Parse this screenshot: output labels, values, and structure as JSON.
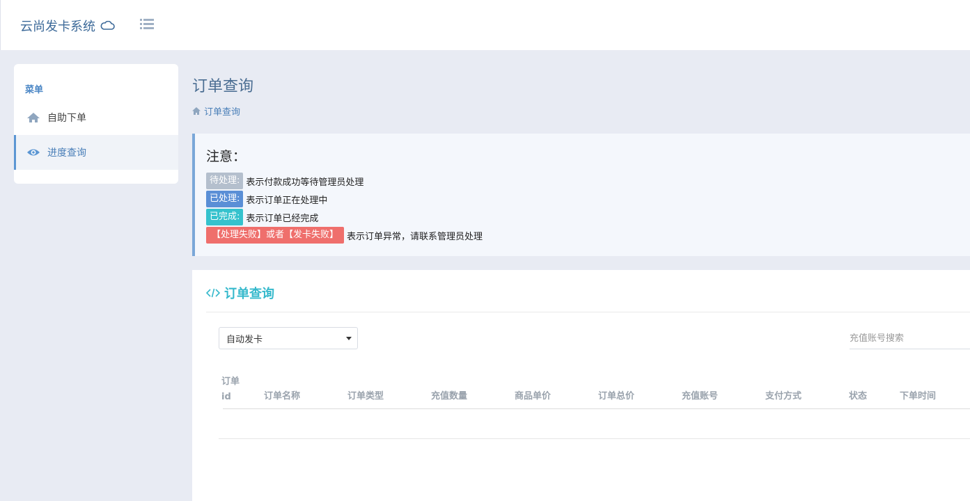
{
  "app": {
    "title": "云尚发卡系统"
  },
  "sidebar": {
    "title": "菜单",
    "items": [
      {
        "label": "自助下单",
        "icon": "home-icon"
      },
      {
        "label": "进度查询",
        "icon": "eye-icon"
      }
    ]
  },
  "page": {
    "title": "订单查询",
    "breadcrumb": "订单查询"
  },
  "notice": {
    "title": "注意：",
    "rows": [
      {
        "tag": "待处理:",
        "text": "表示付款成功等待管理员处理",
        "color": "#b4bfcd"
      },
      {
        "tag": "已处理:",
        "text": "表示订单正在处理中",
        "color": "#5a8fd6"
      },
      {
        "tag": "已完成:",
        "text": "表示订单已经完成",
        "color": "#35c2cd"
      },
      {
        "tag": "【处理失败】或者【发卡失败】",
        "text": "表示订单异常，请联系管理员处理",
        "color": "#ef6f6c"
      }
    ]
  },
  "panel": {
    "title": "订单查询",
    "select": {
      "value": "自动发卡"
    },
    "search": {
      "placeholder": "充值账号搜索"
    },
    "table": {
      "columns": [
        "订单id",
        "订单名称",
        "订单类型",
        "充值数量",
        "商品单价",
        "订单总价",
        "充值账号",
        "支付方式",
        "状态",
        "下单时间"
      ],
      "rows": []
    }
  },
  "colors": {
    "accent": "#36b9cc",
    "brand": "#3d6a99",
    "sidebar_active": "#5b96d3"
  }
}
